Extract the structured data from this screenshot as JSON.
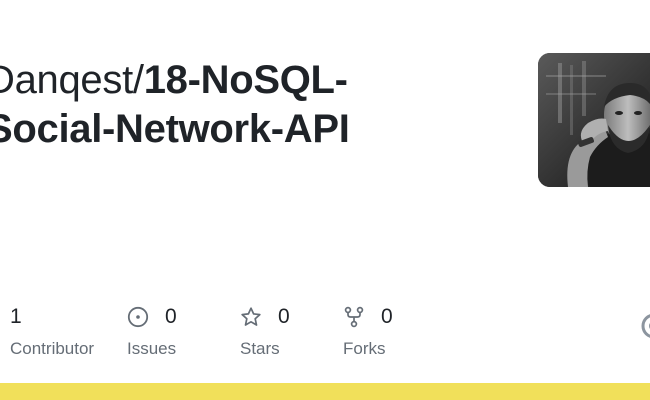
{
  "repo": {
    "owner": "Danqest",
    "separator": "/",
    "name_line1": "18-NoSQL-",
    "name_line2": "Social-Network-API"
  },
  "avatar": {
    "alt": "Danqest avatar"
  },
  "stats": {
    "contributors": {
      "count": "1",
      "label": "Contributor",
      "icon": "people-icon"
    },
    "issues": {
      "count": "0",
      "label": "Issues",
      "icon": "issue-opened-icon"
    },
    "stars": {
      "count": "0",
      "label": "Stars",
      "icon": "star-icon"
    },
    "forks": {
      "count": "0",
      "label": "Forks",
      "icon": "repo-forked-icon"
    }
  },
  "language_bar": {
    "color": "#f1e05a",
    "fraction": 1.0
  },
  "colors": {
    "text": "#1f2328",
    "muted": "#656d76"
  }
}
